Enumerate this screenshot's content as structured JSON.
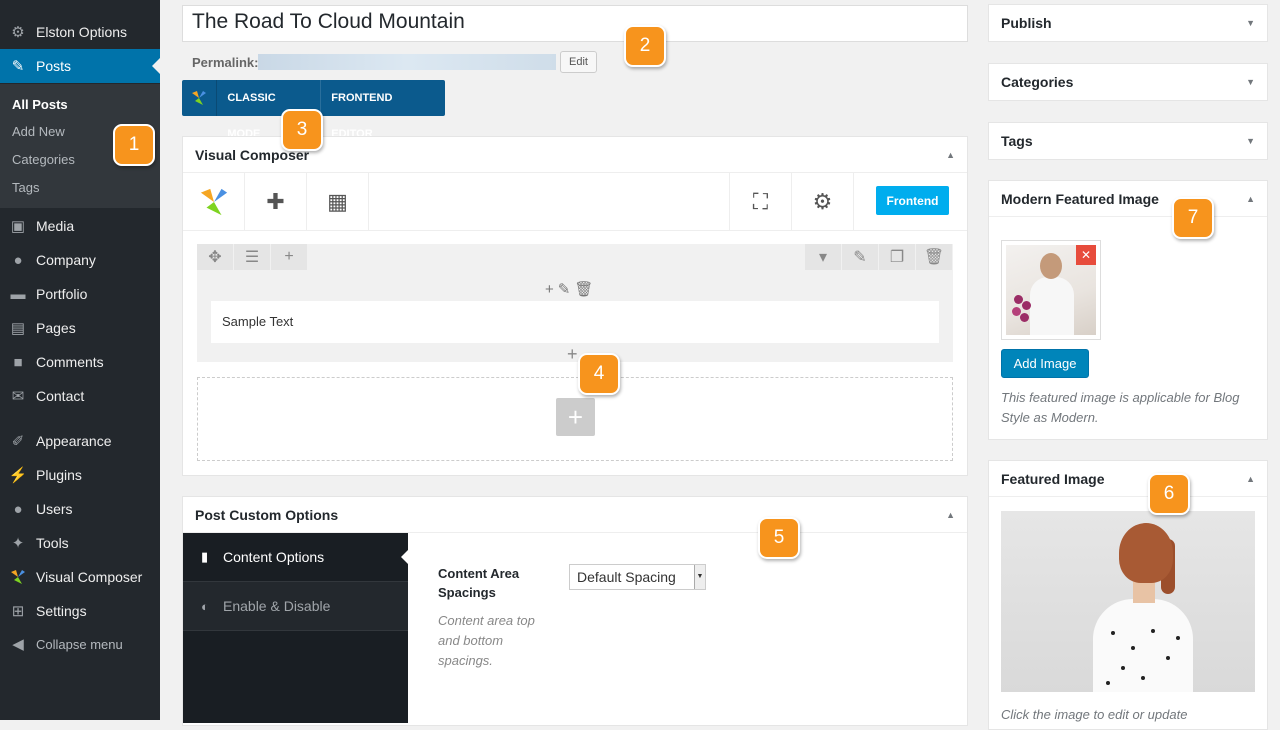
{
  "sidebar": {
    "top_item": "Elston Options",
    "posts": "Posts",
    "submenu": [
      "All Posts",
      "Add New",
      "Categories",
      "Tags"
    ],
    "items": [
      "Media",
      "Company",
      "Portfolio",
      "Pages",
      "Comments",
      "Contact",
      "Appearance",
      "Plugins",
      "Users",
      "Tools",
      "Visual Composer",
      "Settings"
    ],
    "collapse": "Collapse menu"
  },
  "editor": {
    "post_title": "The Road To Cloud Mountain",
    "permalink_label": "Permalink:",
    "edit_label": "Edit",
    "classic_mode": "CLASSIC MODE",
    "frontend_editor": "FRONTEND EDITOR"
  },
  "vc": {
    "title": "Visual Composer",
    "frontend_label": "Frontend",
    "sample_text": "Sample Text"
  },
  "pco": {
    "title": "Post Custom Options",
    "tabs": [
      "Content Options",
      "Enable & Disable"
    ],
    "field_label": "Content Area Spacings",
    "field_desc": "Content area top and bottom spacings.",
    "select_value": "Default Spacing"
  },
  "right": {
    "publish": "Publish",
    "categories": "Categories",
    "tags": "Tags",
    "mfi_title": "Modern Featured Image",
    "add_image": "Add Image",
    "mfi_note": "This featured image is applicable for Blog Style as Modern.",
    "fi_title": "Featured Image",
    "fi_note": "Click the image to edit or update"
  },
  "badges": [
    "1",
    "2",
    "3",
    "4",
    "5",
    "6",
    "7"
  ],
  "colors": {
    "accent": "#0073aa",
    "badge": "#f7941d",
    "vc_blue": "#00adee"
  }
}
